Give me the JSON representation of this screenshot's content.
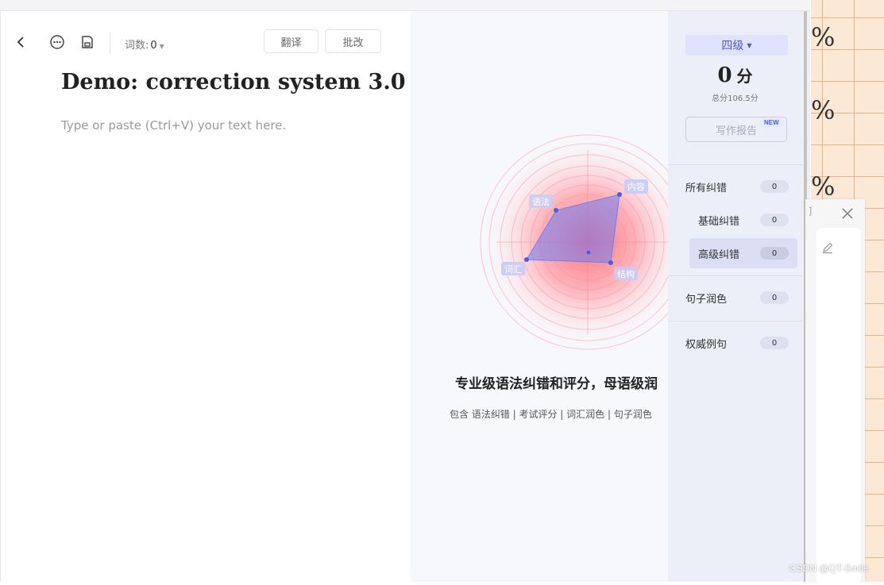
{
  "toolbar": {
    "word_count_label": "词数:",
    "word_count_value": "0",
    "translate_label": "翻译",
    "correct_label": "批改",
    "icons": [
      "back-arrow-icon",
      "more-options-icon",
      "save-icon"
    ]
  },
  "document": {
    "title": "Demo: correction system 3.0",
    "placeholder": "Type or paste (Ctrl+V) your text here."
  },
  "hero": {
    "radar_labels": [
      "内容",
      "结构",
      "词汇",
      "语法"
    ],
    "title": "专业级语法纠错和评分，母语级润",
    "subtitle": "包含 语法纠错 | 考试评分 | 词汇润色 | 句子润色"
  },
  "panel": {
    "level": "四级",
    "score": "0",
    "score_unit": "分",
    "score_total": "总分106.5分",
    "report_label": "写作报告",
    "new_badge": "NEW",
    "categories": [
      {
        "label": "所有纠错",
        "count": "0"
      },
      {
        "label": "基础纠错",
        "count": "0"
      },
      {
        "label": "高级纠错",
        "count": "0"
      },
      {
        "label": "句子润色",
        "count": "0"
      },
      {
        "label": "权威例句",
        "count": "0"
      }
    ]
  },
  "background": {
    "percent_glyph": "%",
    "side_glyph": "]"
  },
  "watermark": "CSDN @QT-Smile",
  "colors": {
    "accent": "#4a5bd6",
    "panel_bg": "#eceef8",
    "radar_fill": "#6f7ef0"
  }
}
